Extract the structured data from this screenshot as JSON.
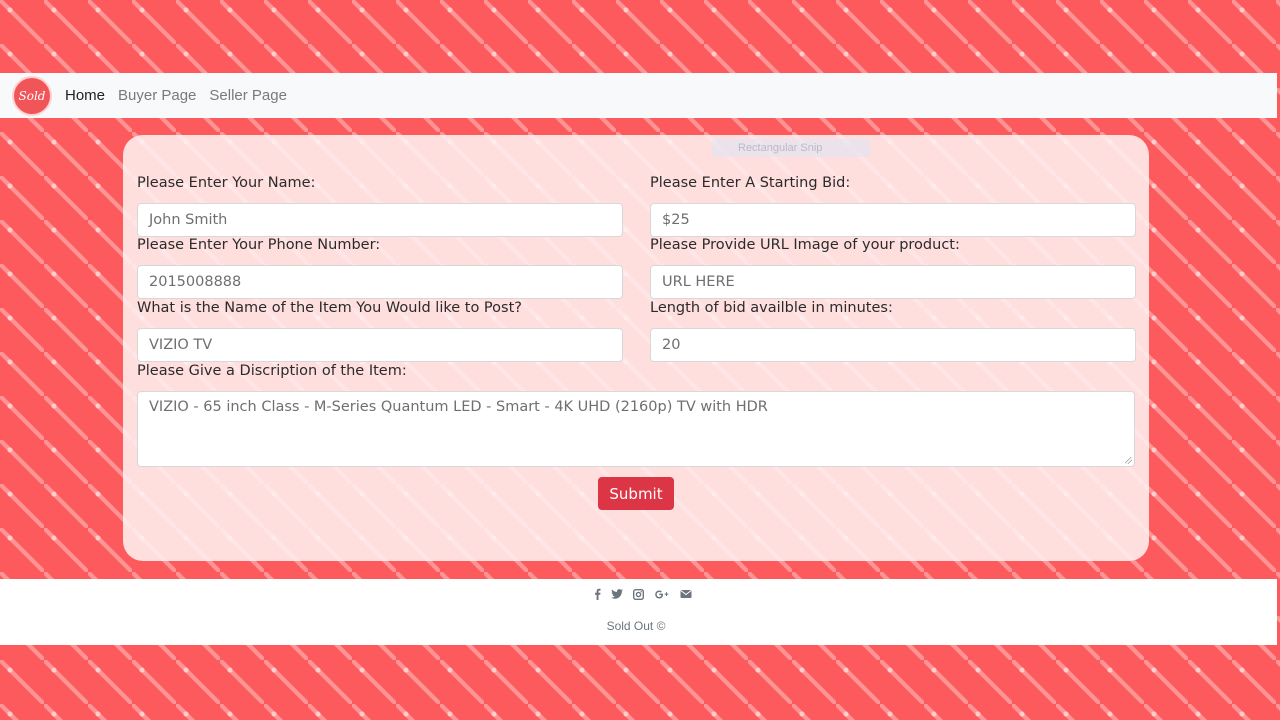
{
  "navbar": {
    "logo_text": "Sold",
    "links": [
      {
        "label": "Home"
      },
      {
        "label": "Buyer Page"
      },
      {
        "label": "Seller Page"
      }
    ]
  },
  "overlay": {
    "snip_label": "Rectangular Snip"
  },
  "form": {
    "name": {
      "label": "Please Enter Your Name:",
      "value": "John Smith"
    },
    "bid": {
      "label": "Please Enter A Starting Bid:",
      "value": "$25"
    },
    "phone": {
      "label": "Please Enter Your Phone Number:",
      "value": "2015008888"
    },
    "image_url": {
      "label": "Please Provide URL Image of your product:",
      "placeholder": "URL HERE"
    },
    "item_name": {
      "label": "What is the Name of the Item You Would like to Post?",
      "value": "VIZIO TV"
    },
    "bid_length": {
      "label": "Length of bid availble in minutes:",
      "value": "20"
    },
    "description": {
      "label": "Please Give a Discription of the Item:",
      "value": "VIZIO - 65 inch Class - M-Series Quantum LED - Smart - 4K UHD (2160p) TV with HDR"
    },
    "submit_label": "Submit"
  },
  "footer": {
    "icons": [
      "facebook-icon",
      "twitter-icon",
      "instagram-icon",
      "google-plus-icon",
      "envelope-icon"
    ],
    "copyright": "Sold Out ©"
  },
  "colors": {
    "background": "#fd5a5e",
    "button": "#dc3545",
    "navbar": "#f8f9fa"
  }
}
